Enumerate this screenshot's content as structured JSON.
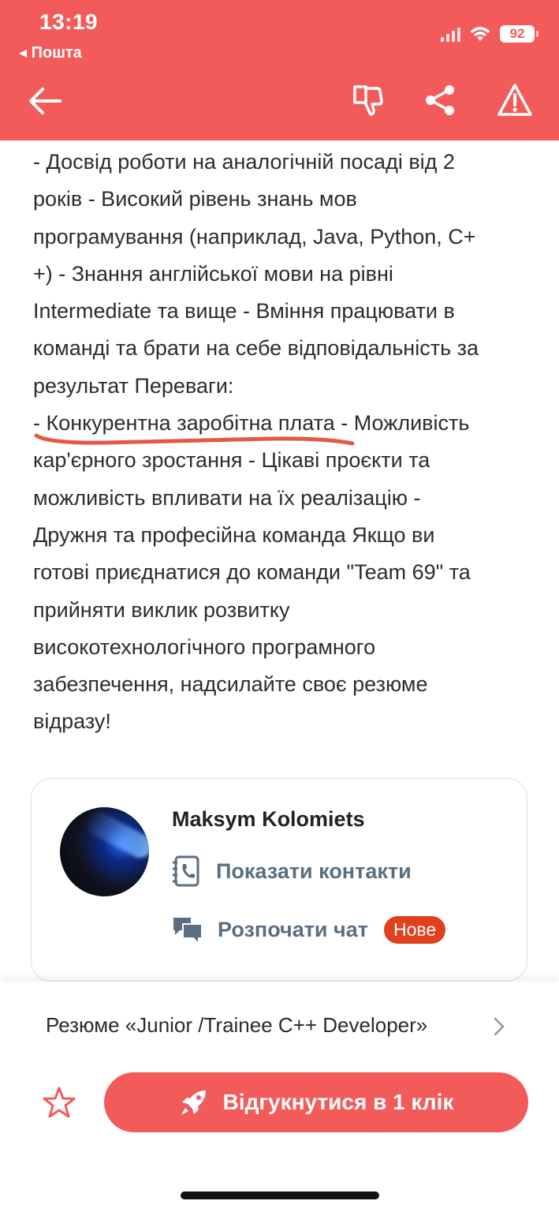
{
  "status_bar": {
    "time": "13:19",
    "back_app": "◂ Пошта",
    "battery": "92"
  },
  "header": {
    "back_icon": "arrow-left-icon",
    "icons": [
      "dislike-icon",
      "share-icon",
      "warning-icon"
    ]
  },
  "description": {
    "lines": [
      "- Досвід роботи на аналогічній посаді від 2",
      "років - Високий рівень знань мов",
      "програмування (наприклад, Java, Python, C+",
      "+) - Знання англійської мови на рівні",
      "Intermediate та вище - Вміння працювати в",
      "команді та брати на себе відповідальність за",
      "результат Переваги:",
      "- Конкурентна заробітна плата - Можливість",
      "кар'єрного зростання - Цікаві проєкти та",
      "можливість впливати на їх реалізацію -",
      "Дружня та професійна команда Якщо ви",
      "готові приєднатися до команди \"Team 69\" та",
      "прийняти виклик розвитку",
      "високотехнологічного програмного",
      "забезпечення, надсилайте своє резюме",
      "відразу!"
    ]
  },
  "contact_card": {
    "name": "Maksym Kolomiets",
    "show_contacts": "Показати контакти",
    "start_chat": "Розпочати чат",
    "badge": "Нове"
  },
  "footer": {
    "resume": "Резюме «Junior /Trainee C++ Developer»",
    "apply": "Відгукнутися в 1 клік"
  },
  "colors": {
    "brand": "#f35b5b",
    "badge": "#e0401c",
    "muted_text": "#5b6e80"
  }
}
